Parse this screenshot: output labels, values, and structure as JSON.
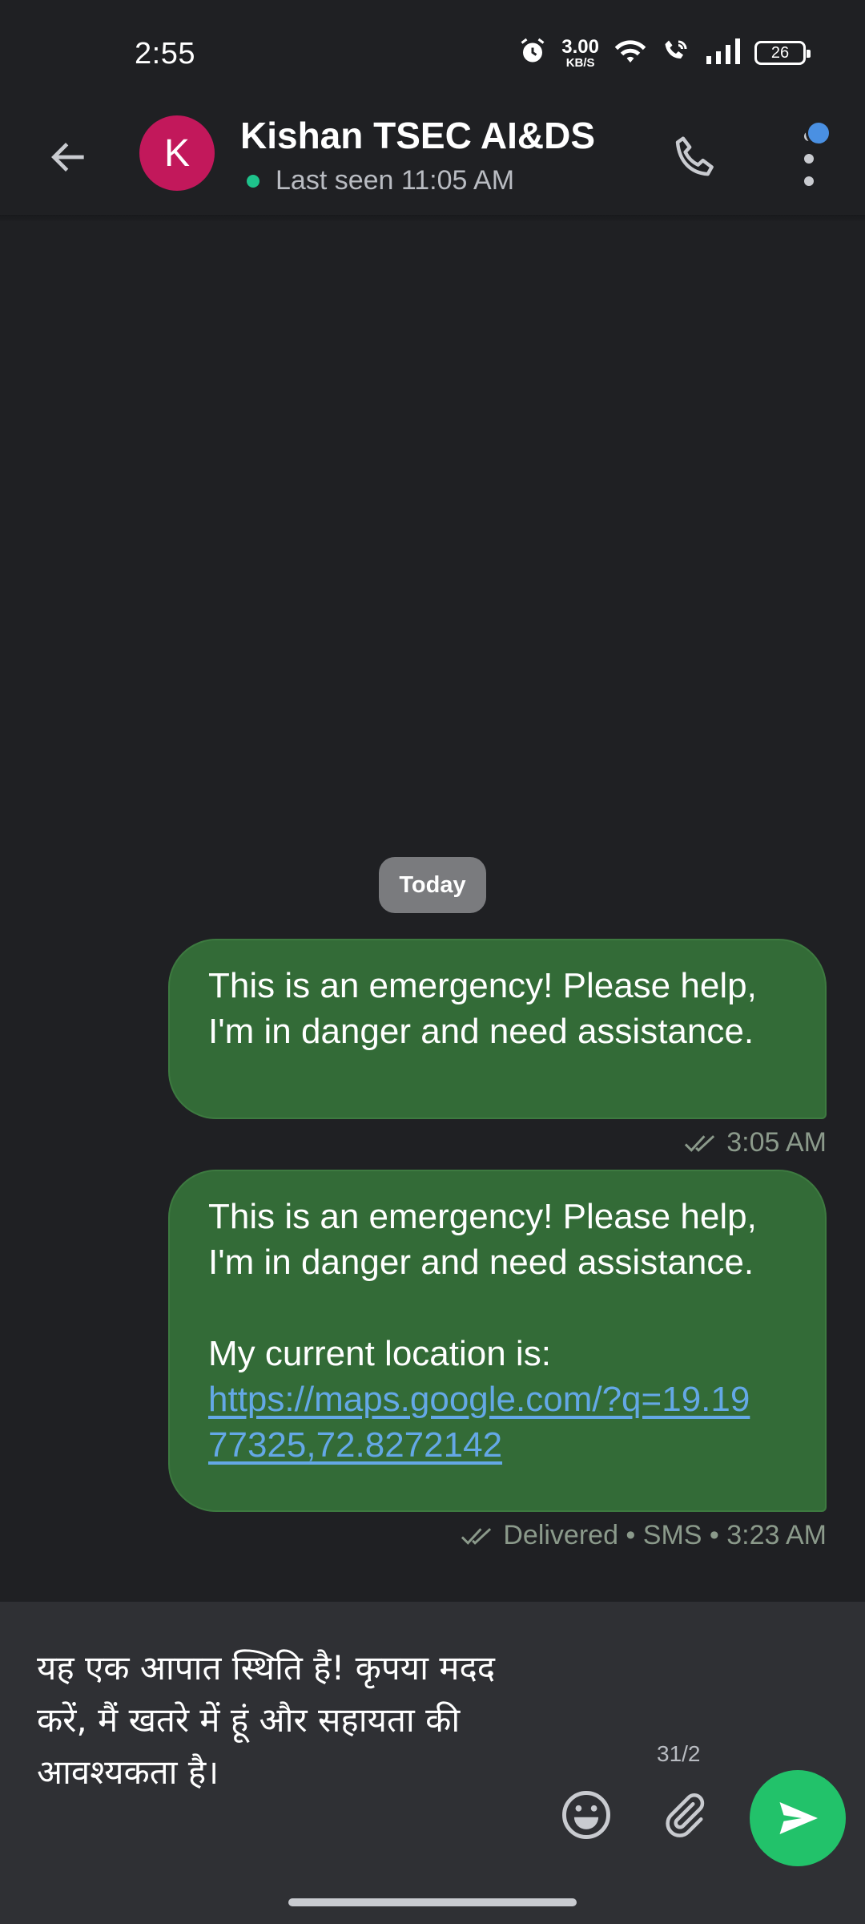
{
  "status_bar": {
    "time": "2:55",
    "net_speed_value": "3.00",
    "net_speed_unit": "KB/S",
    "battery": "26",
    "icons": [
      "alarm-icon",
      "wifi-icon",
      "wifi-call-icon",
      "signal-icon",
      "battery-icon"
    ]
  },
  "header": {
    "avatar_letter": "K",
    "avatar_color": "#c2185b",
    "contact_name": "Kishan TSEC AI&DS",
    "last_seen": "Last seen 11:05 AM",
    "online_color": "#1ec28b",
    "icons": [
      "back-arrow-icon",
      "phone-icon",
      "more-vert-icon"
    ]
  },
  "chat": {
    "date_divider": "Today",
    "bubble_color": "#336b37",
    "messages": [
      {
        "text": "This is an emergency! Please help, I'm in danger and need assistance.",
        "meta": "3:05 AM"
      },
      {
        "text": "This is an emergency! Please help, I'm in danger and need assistance.\n\nMy current location is:",
        "link": "https://maps.google.com/?q=19.1977325,72.8272142",
        "meta": "Delivered • SMS • 3:23 AM"
      }
    ]
  },
  "composer": {
    "input_value": "यह एक आपात स्थिति है! कृपया मदद करें, मैं खतरे में हूं और सहायता की आवश्यकता है।",
    "char_count": "31/2",
    "send_color": "#22c26a",
    "icons": [
      "emoji-icon",
      "attach-icon",
      "send-icon"
    ]
  }
}
